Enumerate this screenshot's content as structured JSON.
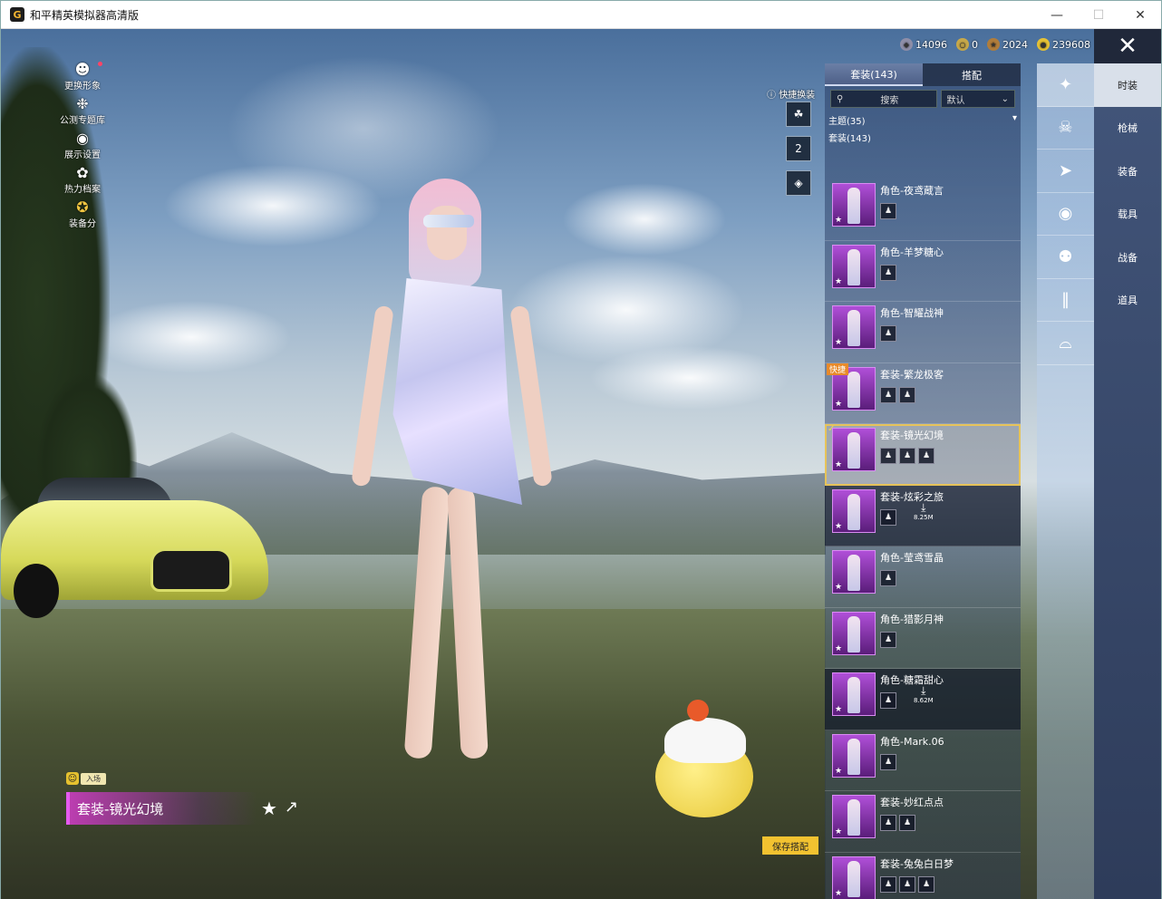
{
  "window": {
    "title": "和平精英模拟器高清版",
    "app_icon": "G"
  },
  "currencies": [
    {
      "icon": "gem-icon",
      "value": "14096"
    },
    {
      "icon": "coin-icon",
      "value": "0"
    },
    {
      "icon": "medal-icon",
      "value": "2024"
    },
    {
      "icon": "gold-coin-icon",
      "value": "239608"
    }
  ],
  "left_menu": [
    {
      "label": "更换形象",
      "icon": "avatar-icon"
    },
    {
      "label": "公测专题库",
      "icon": "puzzle-icon"
    },
    {
      "label": "展示设置",
      "icon": "eye-icon"
    },
    {
      "label": "热力档案",
      "icon": "flame-icon"
    },
    {
      "label": "装备分",
      "icon": "score-badge-icon"
    }
  ],
  "quick_swap": {
    "label": "快捷换装",
    "slot_number": "2"
  },
  "current_outfit": {
    "name": "套装-镜光幻境",
    "entry_label": "入场"
  },
  "panel": {
    "tabs": [
      {
        "label": "套装(143)"
      },
      {
        "label": "搭配"
      }
    ],
    "search_placeholder": "搜索",
    "sort_selected": "默认",
    "themes_label": "主题(35)",
    "suits_label": "套装(143)",
    "save_button": "保存搭配"
  },
  "items": [
    {
      "name": "角色-夜鸢蔵言",
      "subs": 1
    },
    {
      "name": "角色-羊梦糖心",
      "subs": 1
    },
    {
      "name": "角色-智耀战神",
      "subs": 1
    },
    {
      "name": "套装-繁龙极客",
      "subs": 2,
      "badge": "快捷"
    },
    {
      "name": "套装-镜光幻境",
      "subs": 3,
      "selected": true
    },
    {
      "name": "套装-炫彩之旅",
      "subs": 1,
      "download": "8.25M"
    },
    {
      "name": "角色-莹鸢雪晶",
      "subs": 1
    },
    {
      "name": "角色-猎影月神",
      "subs": 1
    },
    {
      "name": "角色-糖霜甜心",
      "subs": 1,
      "download": "8.62M"
    },
    {
      "name": "角色-Mark.06",
      "subs": 1
    },
    {
      "name": "套装-妙红点点",
      "subs": 2
    },
    {
      "name": "套装-兔兔白日梦",
      "subs": 3
    }
  ],
  "categories": [
    "character-icon",
    "head-icon",
    "cap-icon",
    "face-icon",
    "top-icon",
    "pants-icon",
    "shoes-icon"
  ],
  "right_nav": [
    {
      "label": "时装",
      "active": true
    },
    {
      "label": "枪械"
    },
    {
      "label": "装备"
    },
    {
      "label": "载具"
    },
    {
      "label": "战备"
    },
    {
      "label": "道具"
    }
  ]
}
